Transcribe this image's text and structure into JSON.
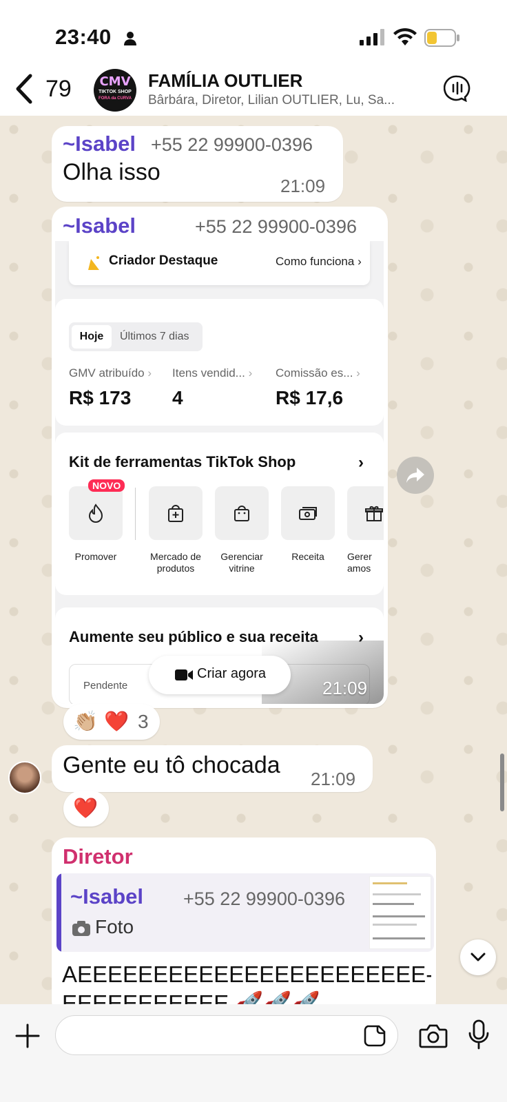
{
  "status": {
    "time": "23:40"
  },
  "header": {
    "back_count": "79",
    "group_name": "FAMÍLIA OUTLIER",
    "members": "Bârbára, Diretor, Lilian OUTLIER, Lu, Sa...",
    "avatar_text": {
      "line1": "CMV",
      "line2": "TIKTOK SHOP",
      "line3": "FORA da CURVA"
    }
  },
  "messages": [
    {
      "sender": "~Isabel",
      "phone": "+55 22 99900-0396",
      "text": "Olha isso",
      "time": "21:09"
    },
    {
      "sender": "~Isabel",
      "phone": "+55 22 99900-0396",
      "time": "21:09",
      "screenshot": {
        "destaque_title": "Criador Destaque",
        "destaque_link": "Como funciona",
        "tab_active": "Hoje",
        "tab_other": "Últimos 7 dias",
        "metrics": [
          {
            "label": "GMV atribuído",
            "value": "R$ 173"
          },
          {
            "label": "Itens vendid...",
            "value": "4"
          },
          {
            "label": "Comissão es...",
            "value": "R$ 17,6"
          }
        ],
        "kit_title": "Kit de ferramentas TikTok Shop",
        "new_badge": "NOVO",
        "tools": [
          {
            "label": "Promover",
            "icon": "flame-icon"
          },
          {
            "label": "Mercado de produtos",
            "icon": "bag-plus-icon"
          },
          {
            "label": "Gerenciar vitrine",
            "icon": "shopping-bag-icon"
          },
          {
            "label": "Receita",
            "icon": "money-icon"
          },
          {
            "label": "Gerer amos",
            "icon": "gift-icon"
          }
        ],
        "grow_title": "Aumente seu público e sua receita",
        "pending_label": "Pendente",
        "cta_label": "Criar agora"
      },
      "reactions": {
        "emojis": "👏🏼 ❤️",
        "count": "3"
      }
    },
    {
      "text": "Gente eu tô chocada",
      "time": "21:09",
      "reactions": {
        "emojis": "❤️"
      }
    },
    {
      "sender": "Diretor",
      "quote": {
        "sender": "~Isabel",
        "phone": "+55 22 99900-0396",
        "text": "Foto"
      },
      "text_line1": "AEEEEEEEEEEEEEEEEEEEEEEE-",
      "text_line2": "EEEEEEEEEEE 🚀🚀🚀"
    }
  ],
  "colors": {
    "sender_isabel": "#5b43c7",
    "sender_diretor": "#d0306e",
    "wallpaper": "#efe8dc"
  }
}
